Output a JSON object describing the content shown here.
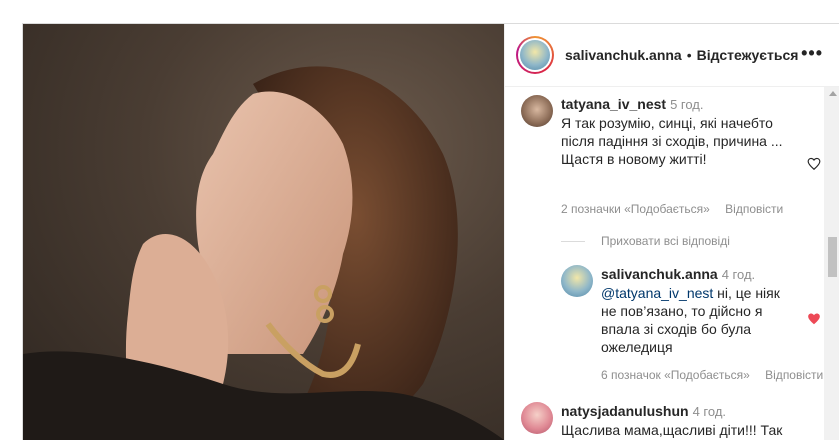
{
  "header": {
    "username": "salivanchuk.anna",
    "separator": "•",
    "follow_label": "Відстежується",
    "more_label": "•••"
  },
  "comments": [
    {
      "username": "tatyana_iv_nest",
      "time": "5 год.",
      "text": "Я так розумію, синці, які начебто після падіння зі сходів, причина ... Щастя в новому житті!",
      "likes": "2 позначки «Подобається»",
      "reply": "Відповісти",
      "hide_replies": "Приховати всі відповіді"
    },
    {
      "username": "salivanchuk.anna",
      "time": "4 год.",
      "mention": "@tatyana_iv_nest",
      "text": " ні, це ніяк не пов’язано, то дійсно я впала зі сходів бо була ожеледиця",
      "likes": "6 позначок «Подобається»",
      "reply": "Відповісти"
    },
    {
      "username": "natysjadanulushun",
      "time": "4 год.",
      "text": "Щаслива мама,щасливі діти!!! Так колись мені мій психолог"
    }
  ],
  "colors": {
    "liked_heart": "#ed4956",
    "mention": "#00376b",
    "meta": "#8e8e8e"
  }
}
